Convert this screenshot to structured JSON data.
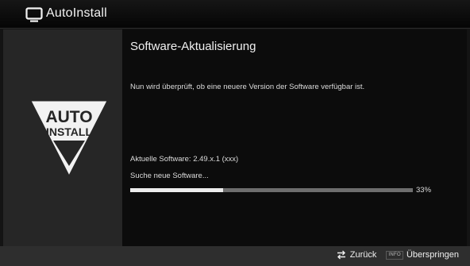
{
  "window": {
    "title": "AutoInstall"
  },
  "logo": {
    "line1": "AUTO",
    "line2": "INSTALL"
  },
  "main": {
    "heading": "Software-Aktualisierung",
    "message": "Nun wird überprüft, ob eine neuere Version der Software verfügbar ist.",
    "current_software": "Aktuelle Software: 2.49.x.1 (xxx)",
    "search_status": "Suche neue Software...",
    "progress": {
      "percent_label": "33%",
      "fraction": 0.33
    }
  },
  "footer": {
    "back_label": "Zurück",
    "info_key_label": "INFO",
    "skip_label": "Überspringen"
  },
  "colors": {
    "background": "#141414",
    "left_panel": "#262626",
    "progress_fill": "#ededed",
    "progress_track": "#6e6e6e"
  },
  "icons": [
    "tv-icon",
    "swap-arrows-icon"
  ]
}
